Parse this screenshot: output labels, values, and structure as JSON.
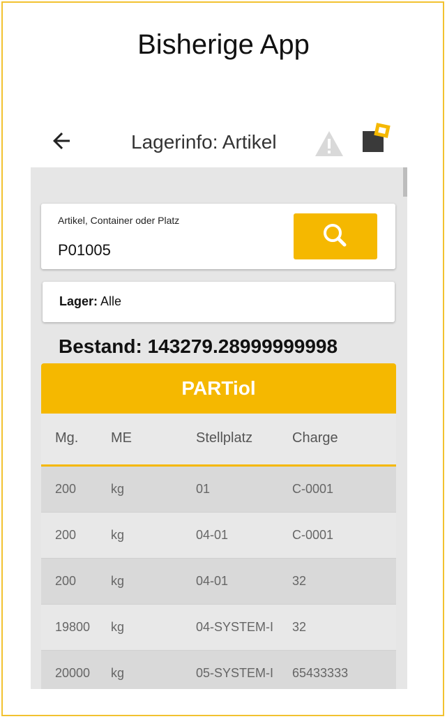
{
  "slide_title": "Bisherige App",
  "app": {
    "title": "Lagerinfo: Artikel",
    "icons": {
      "back": "arrow-left-icon",
      "warning": "warning-icon",
      "logo": "app-logo-icon",
      "search": "search-icon"
    },
    "colors": {
      "accent": "#f5b800",
      "frame": "#f2c230"
    }
  },
  "search": {
    "label": "Artikel, Container oder Platz",
    "value": "P01005"
  },
  "lager": {
    "key": "Lager:",
    "value": "Alle"
  },
  "bestand": "Bestand: 143279.28999999998",
  "section_title": "PARTiol",
  "table": {
    "headers": [
      "Mg.",
      "ME",
      "Stellplatz",
      "Charge"
    ],
    "rows": [
      [
        "200",
        "kg",
        "01",
        "C-0001"
      ],
      [
        "200",
        "kg",
        "04-01",
        "C-0001"
      ],
      [
        "200",
        "kg",
        "04-01",
        "32"
      ],
      [
        "19800",
        "kg",
        "04-SYSTEM-I",
        "32"
      ],
      [
        "20000",
        "kg",
        "05-SYSTEM-I",
        "65433333"
      ]
    ]
  }
}
